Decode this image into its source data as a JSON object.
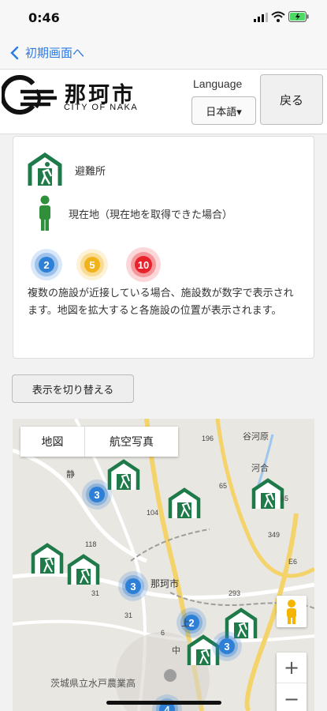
{
  "status_bar": {
    "time": "0:46"
  },
  "nav": {
    "back_label": "初期画面へ"
  },
  "header": {
    "logo_text": "那珂市",
    "logo_sub": "CITY OF NAKA",
    "language_label": "Language",
    "language_value": "日本語▾",
    "back_button": "戻る"
  },
  "legend": {
    "shelter_label": "避難所",
    "current_location_label": "現在地（現在地を取得できた場合）",
    "clusters": [
      {
        "count": "2",
        "color": "#2e7fd6"
      },
      {
        "count": "5",
        "color": "#f2b21b"
      },
      {
        "count": "10",
        "color": "#e8222b"
      }
    ],
    "description": "複数の施設が近接している場合、施設数が数字で表示されます。地図を拡大すると各施設の位置が表示されます。"
  },
  "toggle_button": "表示を切り替える",
  "map": {
    "type_map": "地図",
    "type_satellite": "航空写真",
    "zoom_in": "+",
    "zoom_out": "−",
    "city_label": "那珂市",
    "school_label": "茨城県立水戸農業高",
    "place_labels": [
      "谷河原",
      "河合",
      "静",
      "上",
      "中"
    ],
    "road_numbers": [
      "196",
      "65",
      "104",
      "E6",
      "293",
      "31",
      "31",
      "6",
      "349",
      "118",
      "65"
    ],
    "cluster_markers": [
      {
        "count": "3"
      },
      {
        "count": "3"
      },
      {
        "count": "2"
      },
      {
        "count": "3"
      },
      {
        "count": "4"
      }
    ],
    "colors": {
      "shelter_green": "#1f7a4a",
      "cluster_blue": "#2e7fd6",
      "person_green": "#2f8f3a"
    }
  }
}
